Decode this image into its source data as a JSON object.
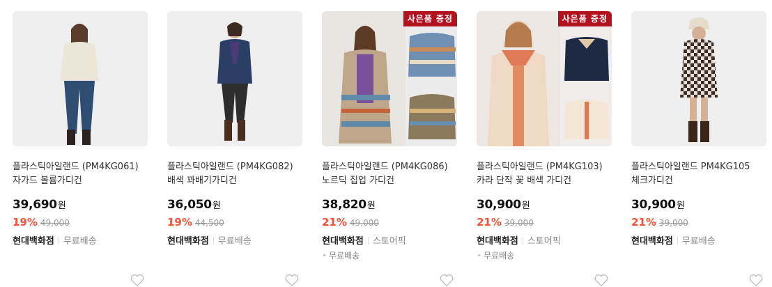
{
  "products": [
    {
      "title_line1": "플라스틱아일랜드 (PM4KG061)",
      "title_line2": "자가드 볼륨가디건",
      "price": "39,690",
      "currency": "원",
      "discount_rate": "19%",
      "original_price": "49,000",
      "store": "현대백화점",
      "tags": [
        "무료배송"
      ],
      "tags2": [],
      "badge": ""
    },
    {
      "title_line1": "플라스틱아일랜드 (PM4KG082)",
      "title_line2": "배색 꽈배기가디건",
      "price": "36,050",
      "currency": "원",
      "discount_rate": "19%",
      "original_price": "44,500",
      "store": "현대백화점",
      "tags": [
        "무료배송"
      ],
      "tags2": [],
      "badge": ""
    },
    {
      "title_line1": "플라스틱아일랜드 (PM4KG086)",
      "title_line2": "노르딕 집업 가디건",
      "price": "38,820",
      "currency": "원",
      "discount_rate": "21%",
      "original_price": "49,000",
      "store": "현대백화점",
      "tags": [
        "스토어픽"
      ],
      "tags2": [
        "무료배송"
      ],
      "badge": "사은품 증정"
    },
    {
      "title_line1": "플라스틱아일랜드 (PM4KG103)",
      "title_line2": "카라 단작 꽃 배색 가디건",
      "price": "30,900",
      "currency": "원",
      "discount_rate": "21%",
      "original_price": "39,000",
      "store": "현대백화점",
      "tags": [
        "스토어픽"
      ],
      "tags2": [
        "무료배송"
      ],
      "badge": "사은품 증정"
    },
    {
      "title_line1": "플라스틱아일랜드 PM4KG105",
      "title_line2": "체크가디건",
      "price": "30,900",
      "currency": "원",
      "discount_rate": "21%",
      "original_price": "39,000",
      "store": "현대백화점",
      "tags": [
        "무료배송"
      ],
      "tags2": [],
      "badge": ""
    }
  ],
  "colors": {
    "discount": "#f0543c",
    "badge": "#b1121d",
    "strike": "#999999"
  },
  "icons": {
    "wishlist": "heart-outline-icon"
  }
}
